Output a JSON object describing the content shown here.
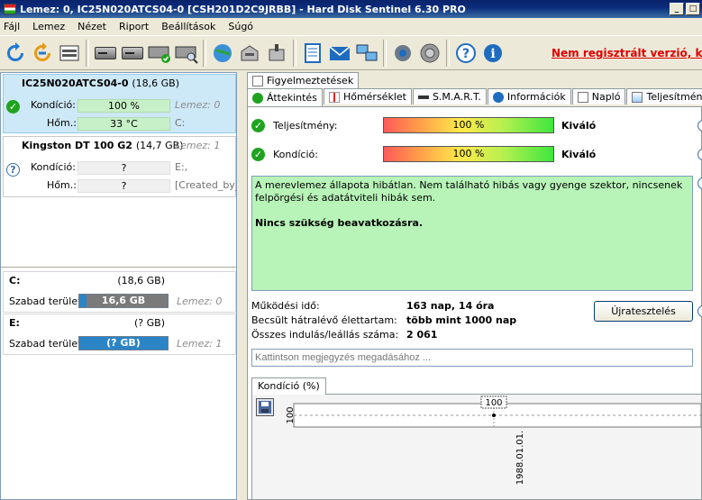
{
  "window": {
    "title": "Lemez: 0, IC25N020ATCS04-0 [CSH201D2C9JRBB] - Hard Disk Sentinel 6.30 PRO",
    "min": "_",
    "restore": "□"
  },
  "menu": [
    "Fájl",
    "Lemez",
    "Nézet",
    "Riport",
    "Beállítások",
    "Súgó"
  ],
  "toolbar": {
    "icons": [
      "refresh-icon",
      "refresh-all-icon",
      "disk-details-icon",
      "disk-icon",
      "disk-schedule-icon",
      "disk-check-icon",
      "disk-search-icon",
      "globe-icon",
      "disk-upload-icon",
      "disk-download-icon",
      "notes-icon",
      "mail-icon",
      "network-icon",
      "settings-icon",
      "sound-icon",
      "help-icon",
      "info-icon"
    ],
    "unregistered": "Nem regisztrált verzió, kér"
  },
  "disks": [
    {
      "name": "IC25N020ATCS04-0",
      "size": "(18,6 GB)",
      "condition_label": "Kondíció:",
      "condition": "100 %",
      "condition_pct": 100,
      "temp_label": "Hőm.:",
      "temp": "33 °C",
      "disk_index": "Lemez: 0",
      "drive": "C:"
    },
    {
      "name": "Kingston DT 100 G2",
      "size": "(14,7 GB)",
      "disk_index": "Lemez: 1",
      "condition_label": "Kondíció:",
      "condition": "?",
      "temp_label": "Hőm.:",
      "temp": "?",
      "drive": "E:,",
      "extra": "[Created_by_K"
    }
  ],
  "volumes": [
    {
      "label": "C:",
      "size": "(18,6 GB)",
      "free_label": "Szabad terület",
      "free": "16,6 GB",
      "disk_index": "Lemez: 0",
      "bar_color": "#7a7a7a"
    },
    {
      "label": "E:",
      "size": "(? GB)",
      "free_label": "Szabad terület",
      "free": "(? GB)",
      "disk_index": "Lemez: 1",
      "bar_color": "#2b84c6"
    }
  ],
  "tabs_top": [
    "Figyelmeztetések"
  ],
  "tabs": [
    "Áttekintés",
    "Hőmérséklet",
    "S.M.A.R.T.",
    "Információk",
    "Napló",
    "Teljesítmény"
  ],
  "overview": {
    "performance_label": "Teljesítmény:",
    "performance": "100 %",
    "performance_rating": "Kiváló",
    "condition_label": "Kondíció:",
    "condition": "100 %",
    "condition_rating": "Kiváló",
    "status_text": "A merevlemez állapota hibátlan. Nem található hibás vagy gyenge szektor, nincsenek felpörgési és adatátviteli hibák sem.",
    "status_action": "Nincs szükség beavatkozásra.",
    "uptime_label": "Működési idő:",
    "uptime": "163 nap, 14 óra",
    "remaining_label": "Becsült hátralévő élettartam:",
    "remaining": "több mint 1000 nap",
    "starts_label": "Összes indulás/leállás száma:",
    "starts": "2 061",
    "retest_button": "Újratesztelés",
    "comment_placeholder": "Kattintson megjegyzés megadásához ..."
  },
  "chart_tab": "Kondíció  (%)",
  "chart_data": {
    "type": "line",
    "x": [
      "1988.01.01."
    ],
    "series": [
      {
        "values": [
          100
        ]
      }
    ],
    "ylabel": "100",
    "data_label": "100"
  },
  "colors": {
    "status_bg": "#b8f4b8",
    "ok_green": "#1fa31f",
    "unregistered_red": "#e00000"
  }
}
